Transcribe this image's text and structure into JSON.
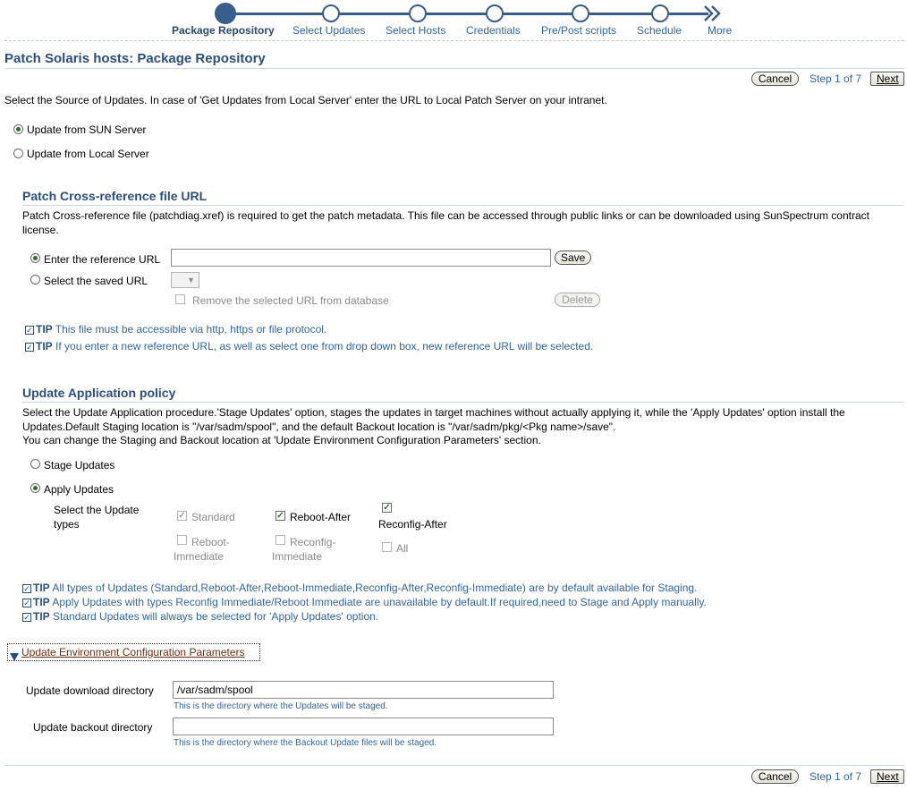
{
  "train": {
    "steps": [
      "Package Repository",
      "Select Updates",
      "Select Hosts",
      "Credentials",
      "Pre/Post scripts",
      "Schedule"
    ],
    "more": "More",
    "more_icon": "double-chevron-right-icon"
  },
  "header": {
    "title": "Patch Solaris hosts: Package Repository",
    "cancel_label": "Cancel",
    "step_text": "Step 1 of 7",
    "next_label": "Next"
  },
  "source": {
    "instructions": "Select the Source of Updates. In case of 'Get Updates from Local Server' enter the URL to Local Patch Server on your intranet.",
    "options": [
      "Update from SUN Server",
      "Update from Local Server"
    ],
    "selected": 0
  },
  "xref": {
    "title": "Patch Cross-reference file URL",
    "description": "Patch Cross-reference file (patchdiag.xref) is required to get the patch metadata. This file can be accessed through public links or can be downloaded using SunSpectrum contract license.",
    "enter_label": "Enter the reference URL",
    "url_value": "",
    "save_label": "Save",
    "saved_label": "Select the saved URL",
    "remove_label": "Remove the selected URL from database",
    "delete_label": "Delete",
    "tip_mark": "TIP",
    "tips": [
      "This file must be accessible via http, https or file protocol.",
      "If you enter a new reference URL, as well as select one from drop down box, new reference URL will be selected."
    ]
  },
  "policy": {
    "title": "Update Application policy",
    "description": "Select the Update Application procedure.'Stage Updates' option, stages the updates in target machines without actually applying it, while the 'Apply Updates' option install the Updates.Default Staging location is \"/var/sadm/spool\", and the default Backout location is \"/var/sadm/pkg/<Pkg name>/save\".",
    "description2": "You can change the Staging and Backout location at 'Update Environment Configuration Parameters' section.",
    "stage_label": "Stage Updates",
    "apply_label": "Apply Updates",
    "types_label": "Select the Update types",
    "types": {
      "standard": "Standard",
      "reboot_after": "Reboot-After",
      "reconfig_after": "Reconfig-After",
      "reboot_immediate": "Reboot-Immediate",
      "reconfig_immediate": "Reconfig-Immediate",
      "all": "All"
    },
    "tip_mark": "TIP",
    "tips": [
      "All types of Updates (Standard,Reboot-After,Reboot-Immediate,Reconfig-After,Reconfig-Immediate) are by default available for Staging.",
      "Apply Updates with types Reconfig Immediate/Reboot Immediate are unavailable by default.If required,need to Stage and Apply manually.",
      "Standard Updates will always be selected for 'Apply Updates' option."
    ]
  },
  "env": {
    "toggle_label": "Update Environment Configuration Parameters",
    "download_label": "Update download directory",
    "download_value": "/var/sadm/spool",
    "download_hint": "This is the directory where the Updates will be staged.",
    "backout_label": "Update backout directory",
    "backout_value": "",
    "backout_hint": "This is the directory where the Backout Update files will be staged."
  },
  "footer": {
    "cancel_label": "Cancel",
    "step_text": "Step 1 of 7",
    "next_label": "Next"
  },
  "colors": {
    "accent": "#3a5e8c",
    "link": "#336699",
    "title": "#2b4e7a"
  }
}
